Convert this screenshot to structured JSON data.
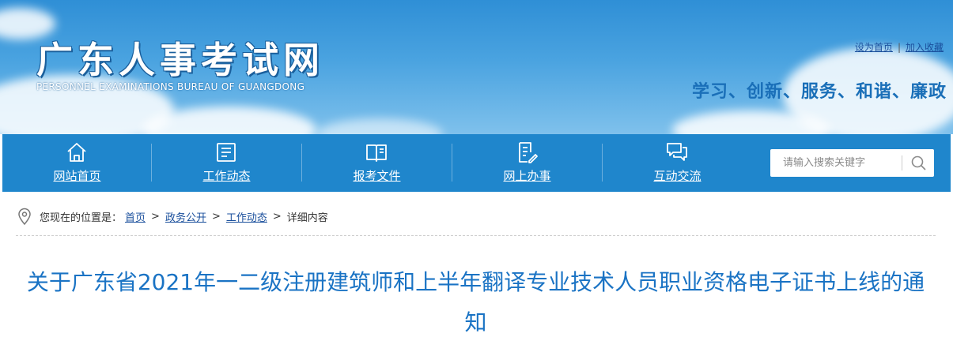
{
  "header": {
    "logo_cn": "广东人事考试网",
    "logo_en": "PERSONNEL EXAMINATIONS BUREAU OF GUANGDONG",
    "links": {
      "set_home": "设为首页",
      "separator": "|",
      "add_favorite": "加入收藏"
    },
    "slogan": "学习、创新、服务、和谐、廉政"
  },
  "nav": {
    "items": [
      {
        "label": "网站首页",
        "icon": "home-icon"
      },
      {
        "label": "工作动态",
        "icon": "news-icon"
      },
      {
        "label": "报考文件",
        "icon": "book-icon"
      },
      {
        "label": "网上办事",
        "icon": "form-edit-icon"
      },
      {
        "label": "互动交流",
        "icon": "chat-icon"
      }
    ],
    "search": {
      "placeholder": "请输入搜索关键字",
      "icon": "search-icon"
    }
  },
  "breadcrumb": {
    "prefix": "您现在的位置是：",
    "items": [
      "首页",
      "政务公开",
      "工作动态"
    ],
    "current": "详细内容",
    "separator": ">"
  },
  "article": {
    "title": "关于广东省2021年一二级注册建筑师和上半年翻译专业技术人员职业资格电子证书上线的通知"
  },
  "colors": {
    "nav_bg": "#1f86cc",
    "title": "#1a73c4",
    "slogan": "#1a6fb8",
    "link": "#1a4f9c"
  }
}
